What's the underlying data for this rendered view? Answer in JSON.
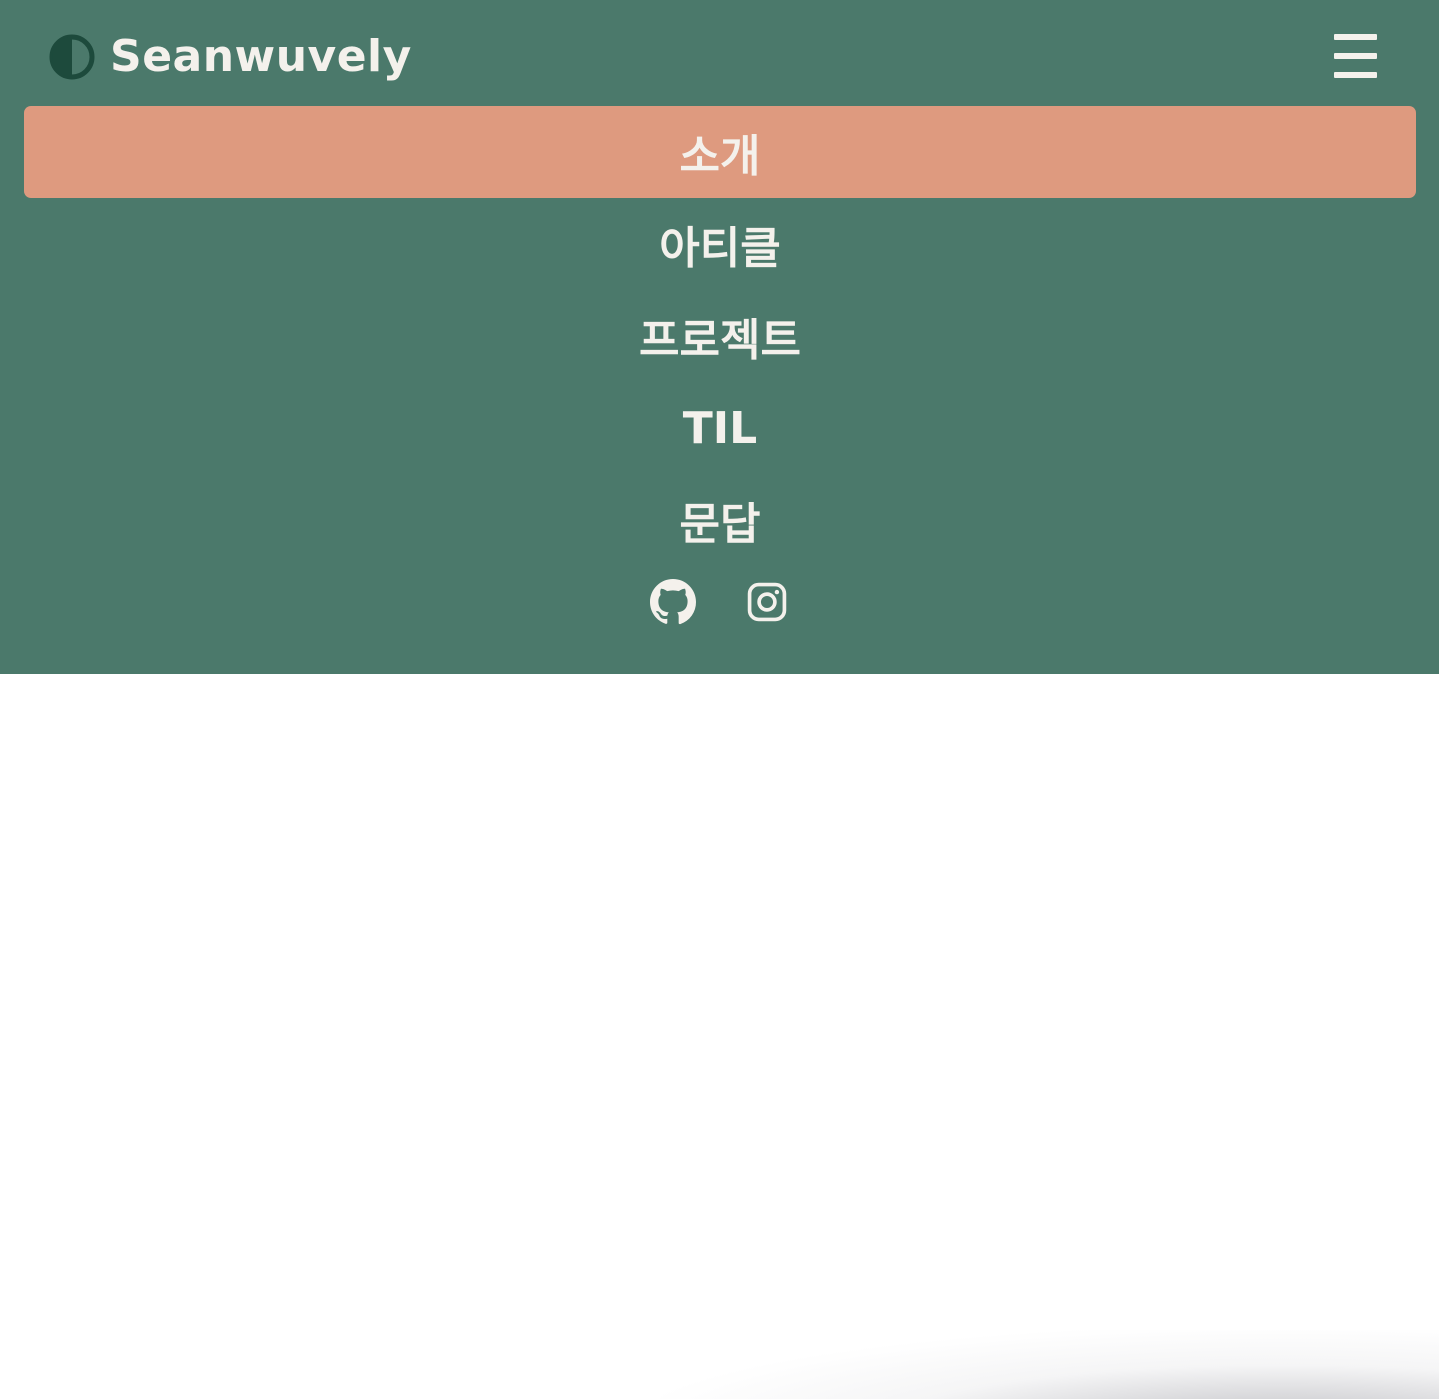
{
  "header": {
    "site_title": "Seanwuvely",
    "theme_toggle_icon": "half-circle-icon",
    "menu_icon": "hamburger-menu-icon",
    "background_color": "#4b796b",
    "accent_color": "#de9a7f",
    "text_color": "#f4f1ec"
  },
  "nav": {
    "items": [
      {
        "label": "소개",
        "active": true
      },
      {
        "label": "아티클",
        "active": false
      },
      {
        "label": "프로젝트",
        "active": false
      },
      {
        "label": "TIL",
        "active": false
      },
      {
        "label": "문답",
        "active": false
      }
    ]
  },
  "social": {
    "links": [
      {
        "icon": "github-icon"
      },
      {
        "icon": "instagram-icon"
      }
    ]
  }
}
